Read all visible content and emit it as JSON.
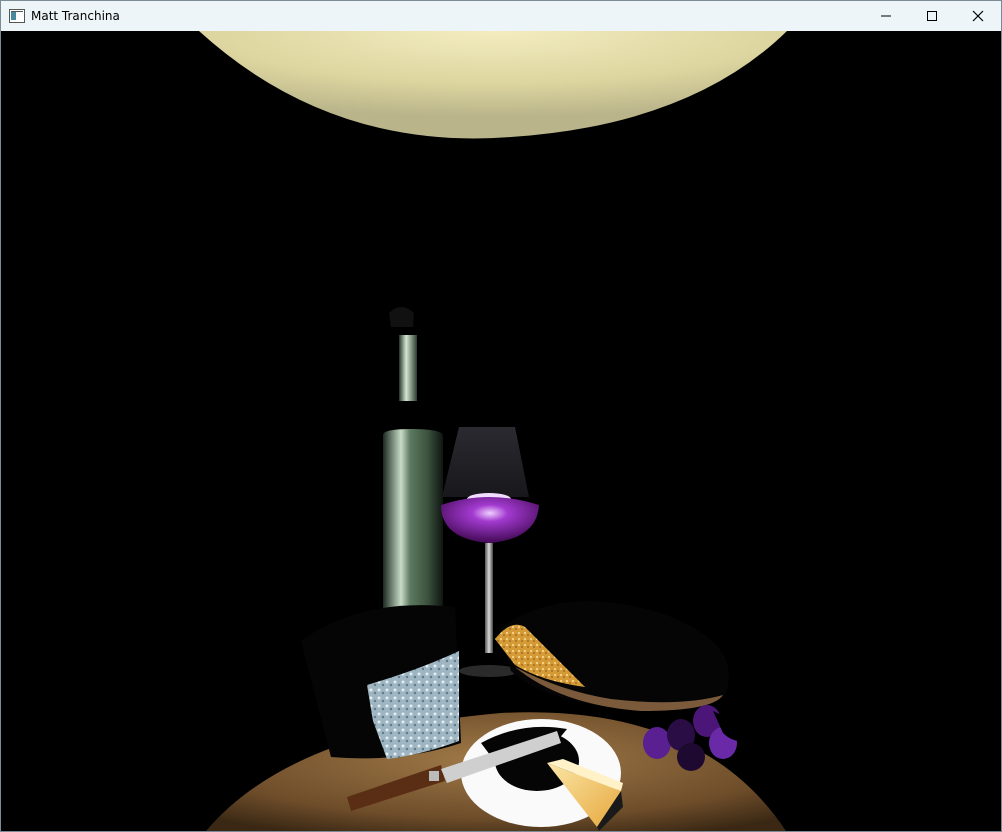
{
  "window": {
    "title": "Matt Tranchina",
    "controls": [
      {
        "name": "minimize-button",
        "icon": "minimize-icon"
      },
      {
        "name": "maximize-button",
        "icon": "maximize-icon"
      },
      {
        "name": "close-button",
        "icon": "close-icon"
      }
    ]
  },
  "scene": {
    "description_objects": [
      "ceiling-light",
      "wine-bottle",
      "wine-glass",
      "lamp-shade",
      "cheese-wheel",
      "bread-loaf",
      "grapes",
      "plate",
      "knife",
      "cheese-wedge",
      "round-table"
    ],
    "colors": {
      "background": "#000000",
      "titlebar": "#eef5f9",
      "table_wood": "#7a5630",
      "wine": "#7a1d9a",
      "bottle_glass": "#6f8a70",
      "cheese_rind": "#a9c1cc",
      "bread_crust": "#c9952f",
      "cheese_wedge": "#f4c76a",
      "plate": "#ffffff",
      "ceiling_light": "#e8e2b0"
    }
  }
}
